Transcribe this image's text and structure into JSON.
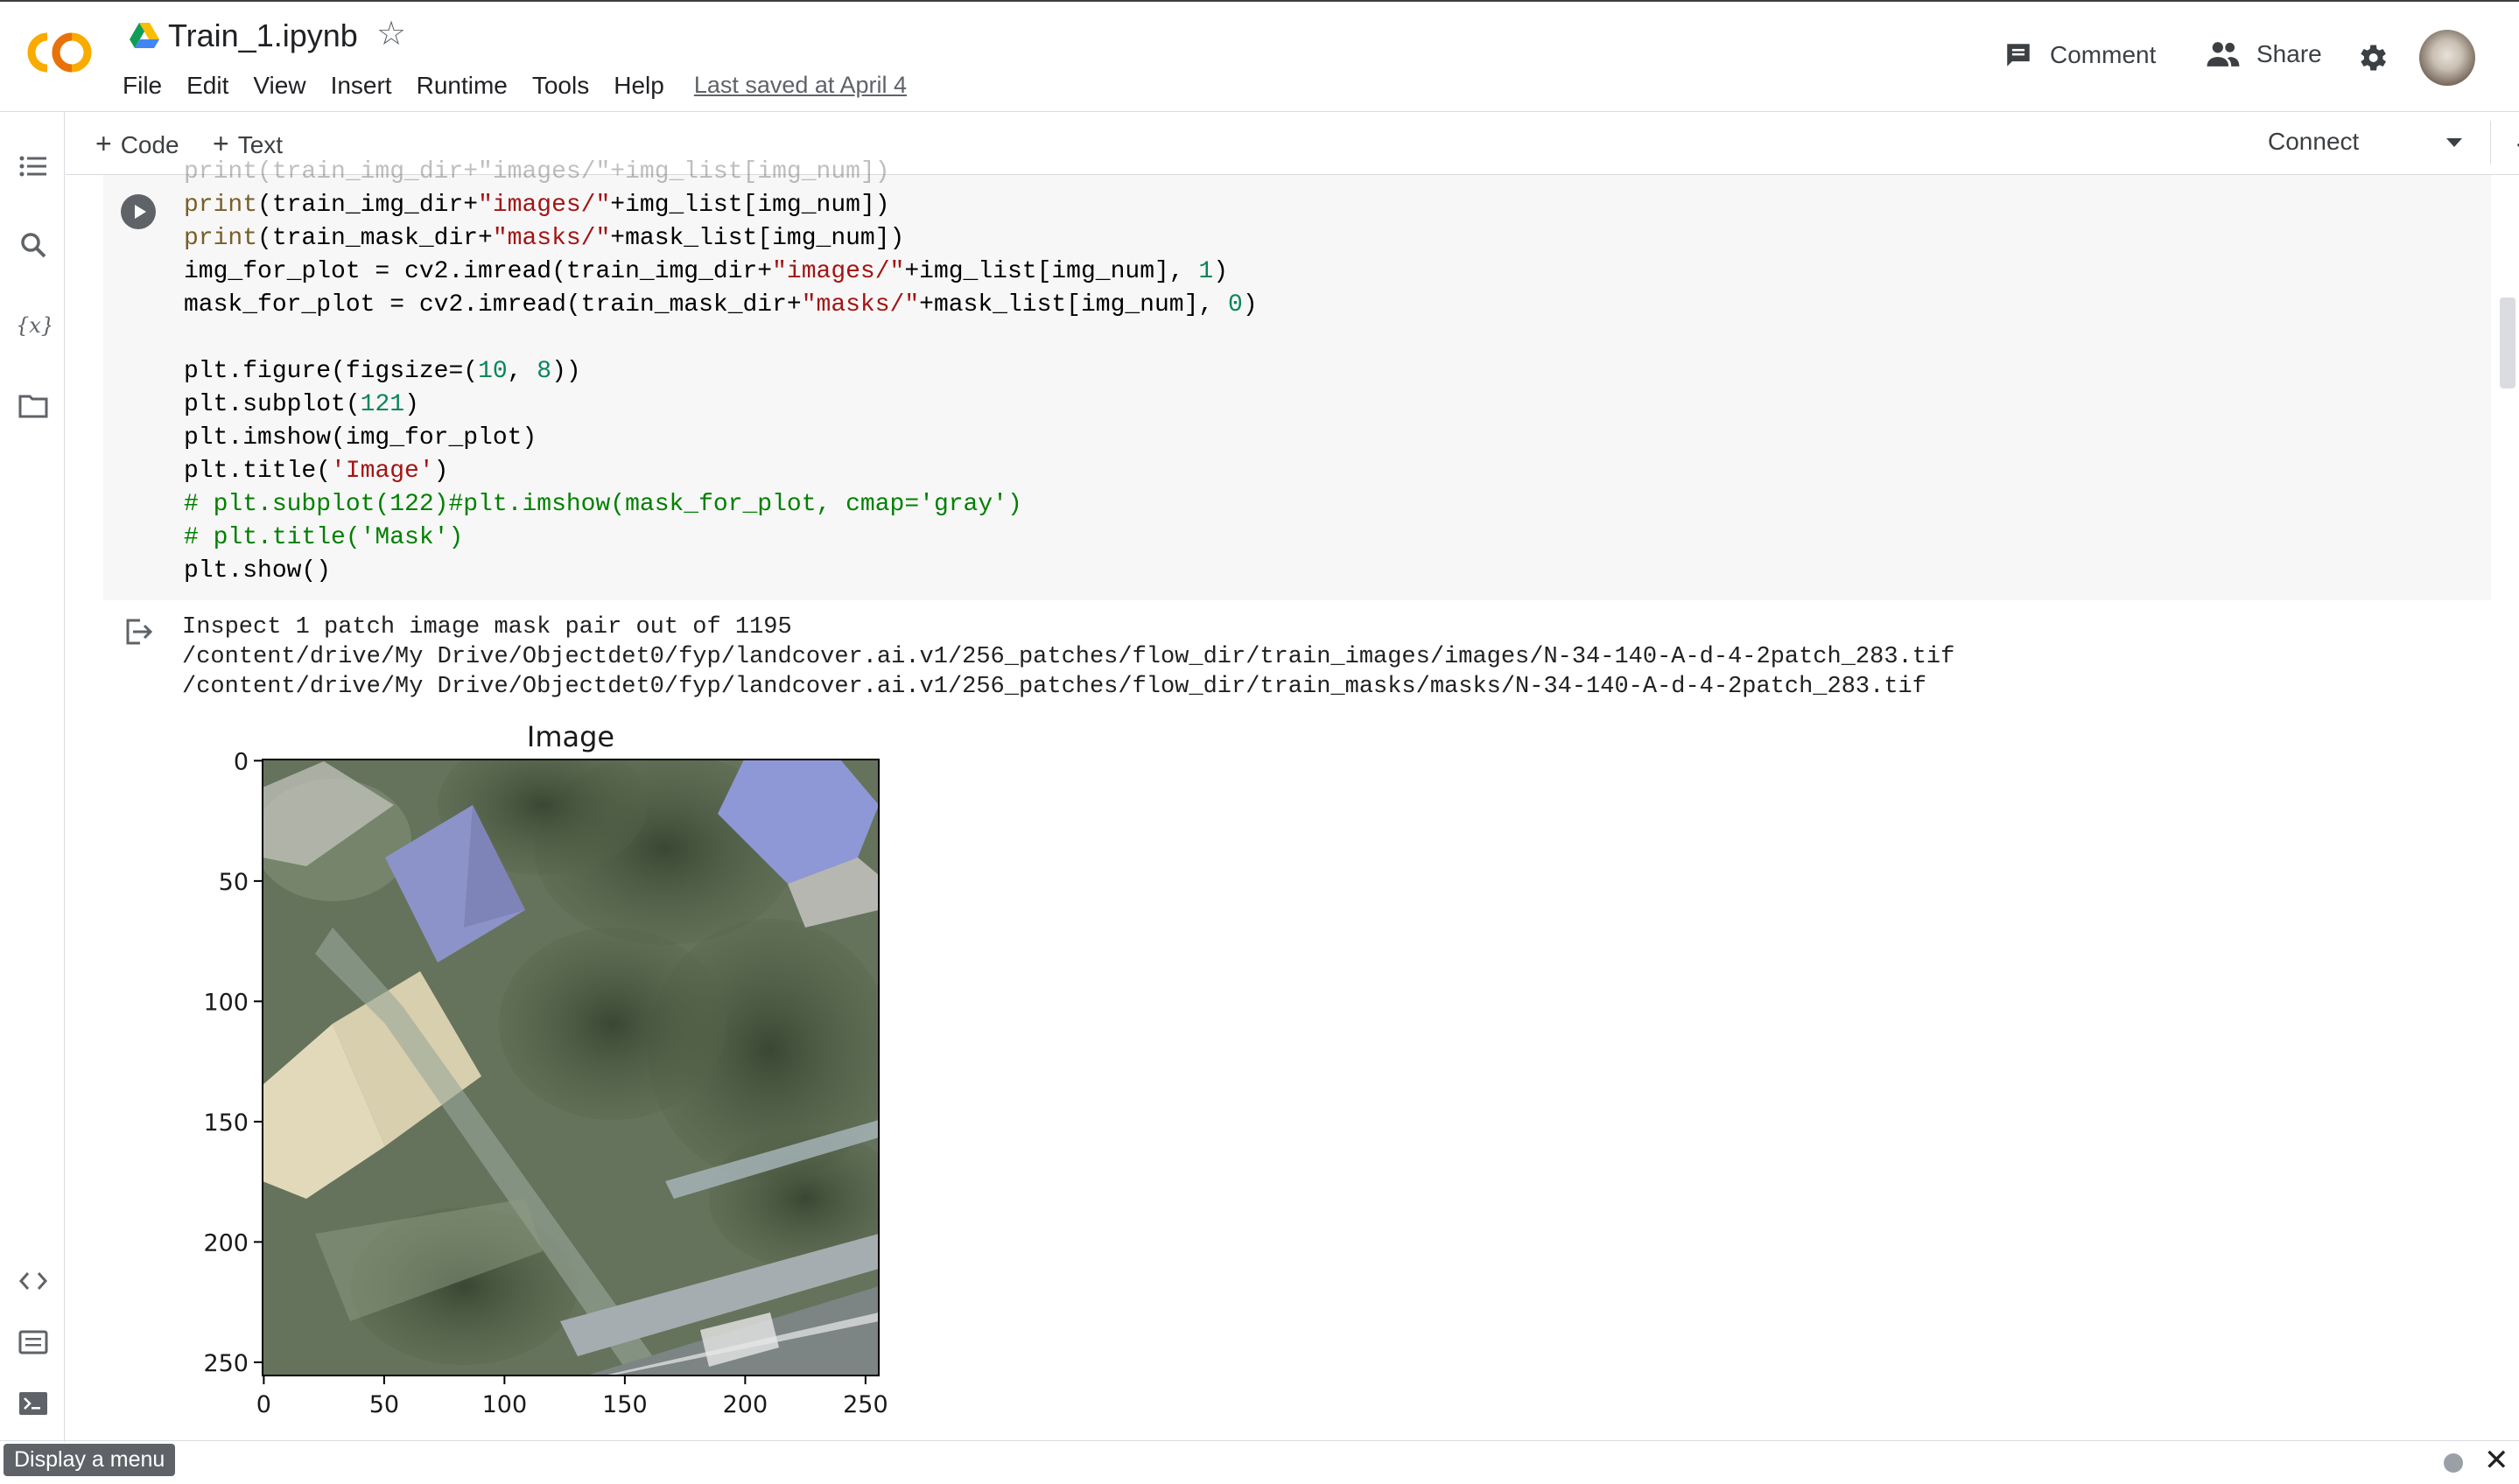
{
  "header": {
    "notebook_title": "Train_1.ipynb",
    "menu": [
      "File",
      "Edit",
      "View",
      "Insert",
      "Runtime",
      "Tools",
      "Help"
    ],
    "last_saved": "Last saved at April 4",
    "comment_label": "Comment",
    "share_label": "Share"
  },
  "toolbar": {
    "add_code": "Code",
    "add_text": "Text",
    "connect_label": "Connect"
  },
  "cell": {
    "code_lines": [
      "print(train_img_dir+\"images/\"+img_list[img_num])",
      "print(train_mask_dir+\"masks/\"+mask_list[img_num])",
      "img_for_plot = cv2.imread(train_img_dir+\"images/\"+img_list[img_num], 1)",
      "mask_for_plot = cv2.imread(train_mask_dir+\"masks/\"+mask_list[img_num], 0)",
      "",
      "plt.figure(figsize=(10, 8))",
      "plt.subplot(121)",
      "plt.imshow(img_for_plot)",
      "plt.title('Image')",
      "# plt.subplot(122)#plt.imshow(mask_for_plot, cmap='gray')",
      "# plt.title('Mask')",
      "plt.show()"
    ]
  },
  "output": {
    "lines": [
      "Inspect 1 patch image mask pair out of 1195",
      "/content/drive/My Drive/Objectdet0/fyp/landcover.ai.v1/256_patches/flow_dir/train_images/images/N-34-140-A-d-4-2patch_283.tif",
      "/content/drive/My Drive/Objectdet0/fyp/landcover.ai.v1/256_patches/flow_dir/train_masks/masks/N-34-140-A-d-4-2patch_283.tif"
    ]
  },
  "chart_data": {
    "type": "image",
    "title": "Image",
    "xlim": [
      0,
      255
    ],
    "ylim": [
      255,
      0
    ],
    "x_ticks": [
      "0",
      "50",
      "100",
      "150",
      "200",
      "250"
    ],
    "y_ticks": [
      "0",
      "50",
      "100",
      "150",
      "200",
      "250"
    ]
  },
  "status": {
    "tooltip": "Display a menu"
  }
}
